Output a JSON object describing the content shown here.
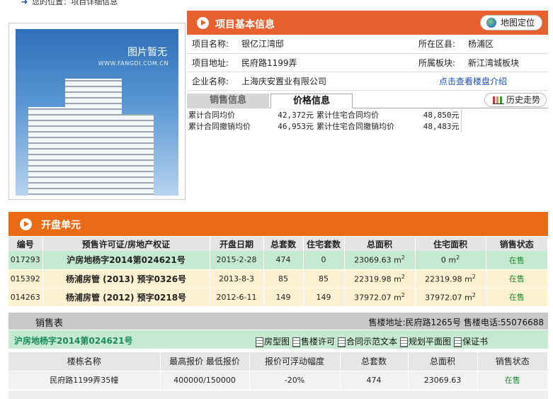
{
  "breadcrumb": "您的位置：项目详细信息",
  "photo": {
    "placeholder": "图片暂无",
    "watermark": "WWW.FANGDI.COM.CN"
  },
  "basic_info": {
    "title": "项目基本信息",
    "map_button": "地图定位",
    "rows": [
      {
        "l1": "项目名称:",
        "v1": "银亿江湾邸",
        "l2": "所在区县:",
        "v2": "杨浦区"
      },
      {
        "l1": "项目地址:",
        "v1": "民府路1199弄",
        "l2": "所属板块:",
        "v2": "新江湾城板块"
      },
      {
        "l1": "企业名称:",
        "v1": "上海庆安置业有限公司",
        "link": "点击查看楼盘介绍"
      }
    ]
  },
  "price_tabs": {
    "tab_sales": "销售信息",
    "tab_price": "价格信息",
    "history_button": "历史走势"
  },
  "price_info": [
    {
      "l1": "累计合同均价",
      "v1": "42,372元",
      "l2": "累计住宅合同均价",
      "v2": "48,850元"
    },
    {
      "l1": "累计合同撤销均价",
      "v1": "46,953元",
      "l2": "累计住宅合同撤销均价",
      "v2": "48,483元"
    }
  ],
  "units_section": {
    "title": "开盘单元",
    "headers": [
      "编号",
      "预售许可证/房地产权证",
      "开盘日期",
      "总套数",
      "住宅套数",
      "总面积",
      "住宅面积",
      "销售状态"
    ],
    "rows": [
      {
        "id": "017293",
        "permit": "沪房地杨字2014第024621号",
        "date": "2015-2-28",
        "total": "474",
        "res": "0",
        "area": "23069.63 m",
        "res_area": "0 m",
        "status": "在售"
      },
      {
        "id": "015392",
        "permit": "杨浦房管 (2013) 预字0326号",
        "date": "2013-8-3",
        "total": "85",
        "res": "85",
        "area": "22319.98 m",
        "res_area": "22319.98 m",
        "status": "在售"
      },
      {
        "id": "014263",
        "permit": "杨浦房管 (2012) 预字0218号",
        "date": "2012-6-11",
        "total": "149",
        "res": "149",
        "area": "37972.07 m",
        "res_area": "37972.07 m",
        "status": "在售"
      }
    ],
    "area_unit_exp": "2"
  },
  "sales_table": {
    "title": "销售表",
    "info": "售楼地址:民府路1265号 售楼电话:55076688",
    "permit": "沪房地杨字2014第024621号",
    "links": [
      "房型图",
      "售楼许可",
      "合同示范文本",
      "规划平面图",
      "保证书"
    ],
    "headers": [
      "楼栋名称",
      "最高报价 最低报价",
      "报价可浮动幅度",
      "总套数",
      "总面积",
      "销售状态"
    ],
    "rows": [
      {
        "name": "民府路1199弄35幢",
        "price": "400000/150000",
        "float": "-20%",
        "total": "474",
        "area": "23069.63",
        "status": "在售"
      }
    ]
  }
}
